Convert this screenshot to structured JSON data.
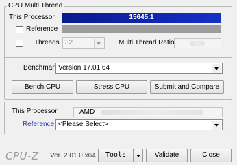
{
  "multi_thread": {
    "group_title": "CPU Multi Thread",
    "this_processor_label": "This Processor",
    "this_processor_score": "15645.1",
    "this_processor_fraction": 1.0,
    "reference_label": "Reference",
    "threads_label": "Threads",
    "threads_value": "32",
    "ratio_label": "Multi Thread Ratio"
  },
  "benchmark": {
    "label": "Benchmark",
    "version_value": "Version 17.01.64",
    "bench_button": "Bench CPU",
    "stress_button": "Stress CPU",
    "submit_button": "Submit and Compare"
  },
  "compare": {
    "this_processor_label": "This Processor",
    "processor_name_prefix": "AMD",
    "reference_label": "Reference",
    "reference_select": "<Please Select>"
  },
  "footer": {
    "logo": "CPU-Z",
    "version": "Ver. 2.01.0.x64",
    "tools_button": "Tools",
    "validate_button": "Validate",
    "close_button": "Close"
  },
  "colors": {
    "bar_fill": "#1630c8",
    "bar_background": "#9d9d9d",
    "link": "#2a35c8"
  }
}
